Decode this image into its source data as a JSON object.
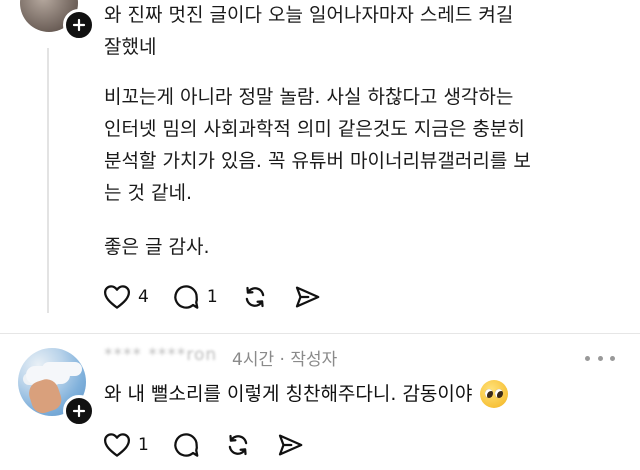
{
  "post": {
    "header_line": "와 진짜 멋진 글이다 오늘 일어나자마자 스레드 켜길",
    "paragraph1": "잘했네",
    "paragraph2": [
      "비꼬는게 아니라 정말 놀람. 사실 하찮다고 생각하는",
      "인터넷 밈의 사회과학적 의미 같은것도 지금은 충분히",
      "분석할 가치가 있음. 꼭 유튜버 마이너리뷰갤러리를 보",
      "는 것 같네."
    ],
    "paragraph3": "좋은 글 감사.",
    "actions": {
      "like_count": "4",
      "comment_count": "1"
    }
  },
  "reply": {
    "username": "**** ****ron",
    "time": "4시간",
    "separator": "·",
    "author_badge": "작성자",
    "text": "와 내 뻘소리를 이렇게 칭찬해주다니. 감동이야",
    "emoji": "pleading-face-icon",
    "actions": {
      "like_count": "1"
    }
  }
}
